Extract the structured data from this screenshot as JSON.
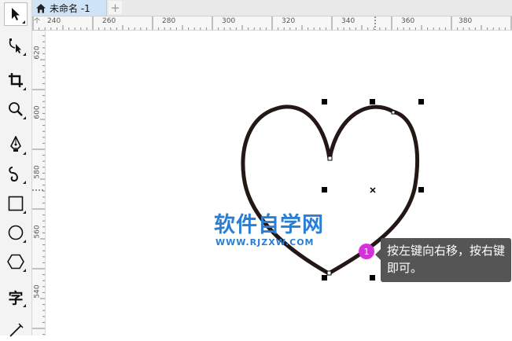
{
  "document_tab": {
    "title": "未命名 -1",
    "add_label": "+"
  },
  "ruler_top": {
    "ticks": [
      "240",
      "260",
      "280",
      "300",
      "320",
      "340",
      "360",
      "380"
    ],
    "corner": "个"
  },
  "ruler_left": {
    "ticks": [
      "620",
      "600",
      "580",
      "560",
      "540"
    ]
  },
  "toolbox": [
    {
      "name": "pick-tool",
      "icon": "arrow-pointer-icon"
    },
    {
      "name": "shape-tool",
      "icon": "node-edit-icon"
    },
    {
      "name": "crop-tool",
      "icon": "crop-icon"
    },
    {
      "name": "zoom-tool",
      "icon": "magnifier-icon"
    },
    {
      "name": "freehand-tool",
      "icon": "pen-nib-icon"
    },
    {
      "name": "artistic-media-tool",
      "icon": "curve-icon"
    },
    {
      "name": "rectangle-tool",
      "icon": "rectangle-icon"
    },
    {
      "name": "ellipse-tool",
      "icon": "ellipse-icon"
    },
    {
      "name": "polygon-tool",
      "icon": "hexagon-icon"
    },
    {
      "name": "text-tool",
      "icon": "text-icon",
      "label": "字"
    },
    {
      "name": "line-tool",
      "icon": "dimension-line-icon"
    }
  ],
  "watermark": {
    "title": "软件自学网",
    "url": "WWW.RJZXW.COM"
  },
  "hint": {
    "number": "1",
    "text": "按左键向右移，按右键即可。"
  },
  "colors": {
    "heart_stroke": "#231815",
    "watermark": "#2a7fd4",
    "badge": "#d82fdd",
    "tooltip_bg": "#555555",
    "tab_active": "#cfe3f7"
  }
}
